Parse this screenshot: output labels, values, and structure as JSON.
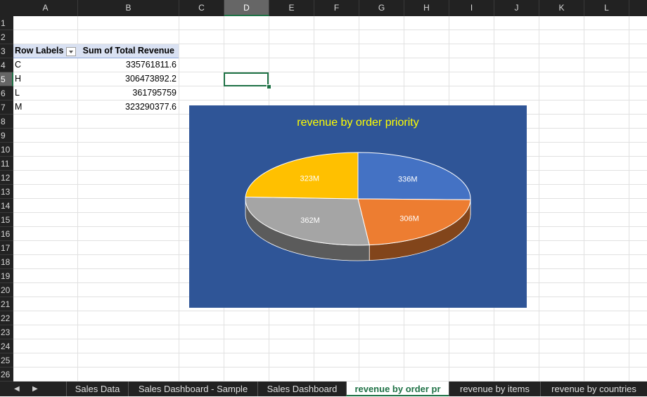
{
  "columns": [
    "A",
    "B",
    "C",
    "D",
    "E",
    "F",
    "G",
    "H",
    "I",
    "J",
    "K",
    "L"
  ],
  "selected_column": "D",
  "rows": [
    "1",
    "2",
    "3",
    "4",
    "5",
    "6",
    "7",
    "8",
    "9",
    "10",
    "11",
    "12",
    "13",
    "14",
    "15",
    "16",
    "17",
    "18",
    "19",
    "20",
    "21",
    "22",
    "23",
    "24",
    "25",
    "26"
  ],
  "selected_row": "5",
  "pivot": {
    "header_row_labels": "Row Labels",
    "header_sum": "Sum of Total Revenue",
    "rows": [
      {
        "label": "C",
        "value": "335761811.6"
      },
      {
        "label": "H",
        "value": "306473892.2"
      },
      {
        "label": "L",
        "value": "361795759"
      },
      {
        "label": "M",
        "value": "323290377.6"
      }
    ]
  },
  "chart_data": {
    "type": "pie",
    "title": "revenue by order priority",
    "categories": [
      "C",
      "H",
      "L",
      "M"
    ],
    "values": [
      335761811.6,
      306473892.2,
      361795759,
      323290377.6
    ],
    "data_labels": [
      "336M",
      "306M",
      "362M",
      "323M"
    ],
    "colors": [
      "#4472c4",
      "#ed7d31",
      "#a5a5a5",
      "#ffc000"
    ],
    "background": "#2f5597",
    "title_color": "#ffff00",
    "style": "3D pie",
    "legend": "none"
  },
  "sheet_tabs": [
    "Sales Data",
    "Sales Dashboard - Sample",
    "Sales Dashboard",
    "revenue by order pr",
    "revenue by items",
    "revenue by countries"
  ],
  "active_tab": "revenue by order pr",
  "colors": {
    "accent": "#1e7145",
    "header_bg": "#222222",
    "pivot_header_bg": "#d9e1f2"
  }
}
